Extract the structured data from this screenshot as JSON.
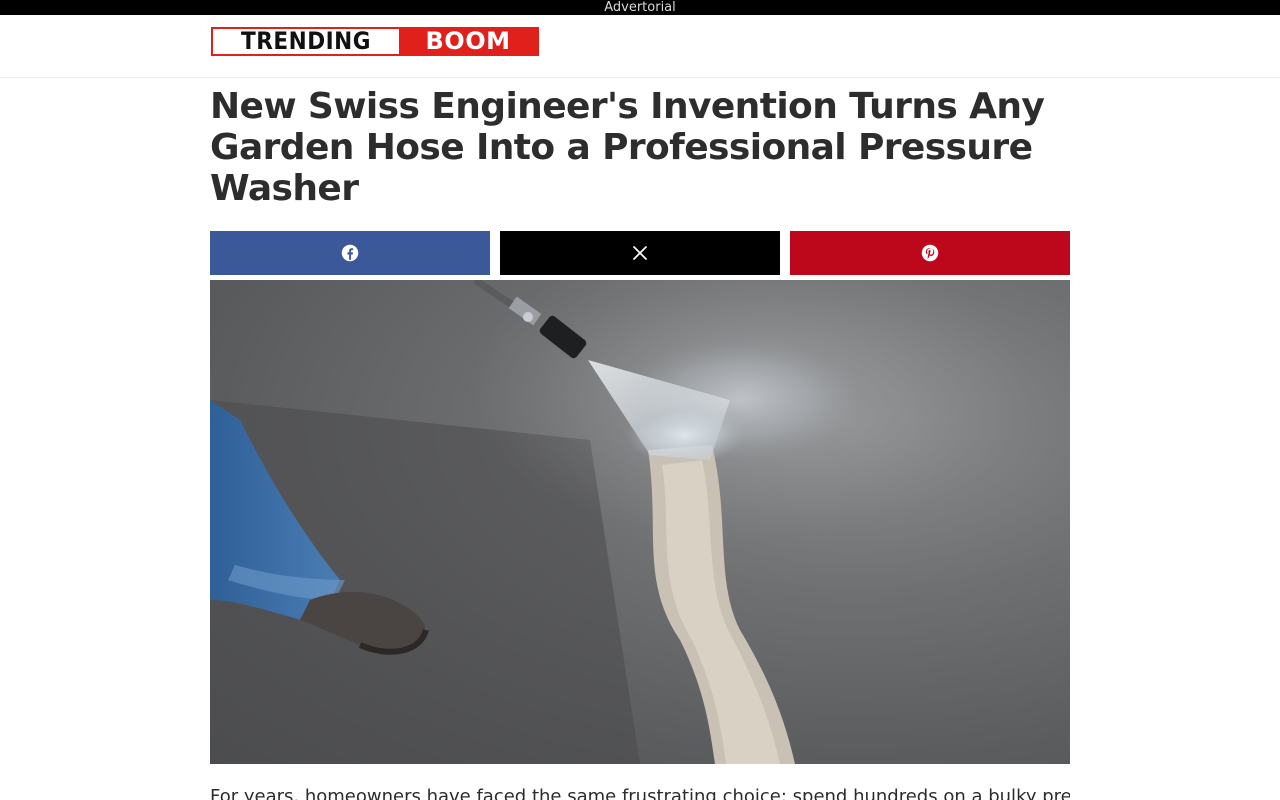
{
  "adbar": {
    "label": "Advertorial"
  },
  "logo": {
    "part1": "TRENDING",
    "part2": "BOOM"
  },
  "article": {
    "title": "New Swiss Engineer's Invention Turns Any Garden Hose Into a Professional Pressure Washer",
    "intro": "For years, homeowners have faced the same frustrating choice: spend hundreds on a bulky pressure"
  },
  "share": {
    "facebook": {
      "icon": "facebook-icon",
      "color": "#3b5998"
    },
    "x": {
      "icon": "x-icon",
      "color": "#000000"
    },
    "pinterest": {
      "icon": "pinterest-icon",
      "color": "#bd081c"
    }
  },
  "colors": {
    "brand_red": "#e0201b"
  }
}
